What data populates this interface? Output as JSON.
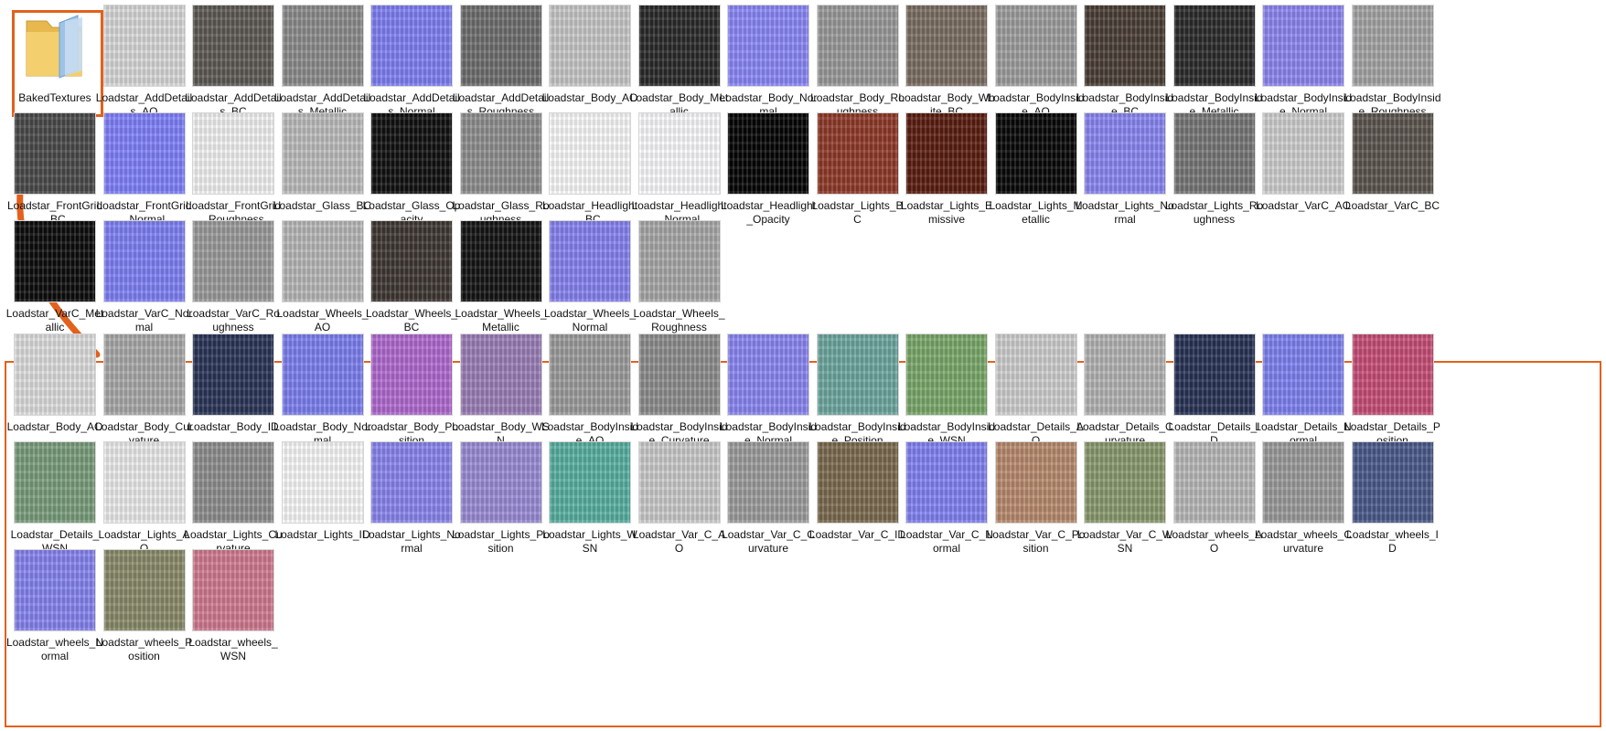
{
  "folder": {
    "name": "BakedTextures",
    "icon": "folder-icon"
  },
  "accent_color": "#e2611c",
  "textures": [
    {
      "label": "Loadstar_AddDetails_AO",
      "color": "#d9d9d9"
    },
    {
      "label": "Loadstar_AddDetails_BC",
      "color": "#5e5a55"
    },
    {
      "label": "Loadstar_AddDetails_Metallic",
      "color": "#8c8c8c"
    },
    {
      "label": "Loadstar_AddDetails_Normal",
      "color": "#7f7ff3"
    },
    {
      "label": "Loadstar_AddDetails_Roughness",
      "color": "#6e6e6e"
    },
    {
      "label": "Loadstar_Body_AO",
      "color": "#c8c8c8"
    },
    {
      "label": "Loadstar_Body_Metallic",
      "color": "#2a2a2a"
    },
    {
      "label": "Loadstar_Body_Normal",
      "color": "#8a88f7"
    },
    {
      "label": "Loadstar_Body_Roughness",
      "color": "#9a9a9a"
    },
    {
      "label": "Loadstar_Body_White_BC",
      "color": "#7a6e62"
    },
    {
      "label": "Loadstar_BodyInside_AO",
      "color": "#9e9e9e"
    },
    {
      "label": "Loadstar_BodyInside_BC",
      "color": "#4a3f36"
    },
    {
      "label": "Loadstar_BodyInside_Metallic",
      "color": "#2b2b2b"
    },
    {
      "label": "Loadstar_BodyInside_Normal",
      "color": "#8d86f0"
    },
    {
      "label": "Loadstar_BodyInside_Roughness",
      "color": "#a5a5a5"
    },
    {
      "label": "Loadstar_FrontGrid_BC",
      "color": "#4a4a4a"
    },
    {
      "label": "Loadstar_FrontGrid_Normal",
      "color": "#8080fb"
    },
    {
      "label": "Loadstar_FrontGrid_Roughness",
      "color": "#f3f3f3"
    },
    {
      "label": "Loadstar_Glass_BC",
      "color": "#bdbdbd"
    },
    {
      "label": "Loadstar_Glass_Opacity",
      "color": "#111111"
    },
    {
      "label": "Loadstar_Glass_Roughness",
      "color": "#8e8e8e"
    },
    {
      "label": "Loadstar_Headlight_BC",
      "color": "#fbfbfb"
    },
    {
      "label": "Loadstar_Headlight_Normal",
      "color": "#fcfcff"
    },
    {
      "label": "Loadstar_Headlight_Opacity",
      "color": "#050505"
    },
    {
      "label": "Loadstar_Lights_BC",
      "color": "#8e3a28"
    },
    {
      "label": "Loadstar_Lights_Emissive",
      "color": "#5a1d10"
    },
    {
      "label": "Loadstar_Lights_Metallic",
      "color": "#080808"
    },
    {
      "label": "Loadstar_Lights_Normal",
      "color": "#8a86f2"
    },
    {
      "label": "Loadstar_Lights_Roughness",
      "color": "#777777"
    },
    {
      "label": "Loadstar_VarC_AO",
      "color": "#cfcfcf"
    },
    {
      "label": "Loadstar_VarC_BC",
      "color": "#5c554f"
    },
    {
      "label": "Loadstar_VarC_Metallic",
      "color": "#0d0d0d"
    },
    {
      "label": "Loadstar_VarC_Normal",
      "color": "#7f80f4"
    },
    {
      "label": "Loadstar_VarC_Roughness",
      "color": "#9b9b9b"
    },
    {
      "label": "Loadstar_Wheels_AO",
      "color": "#b8b8b8"
    },
    {
      "label": "Loadstar_Wheels_BC",
      "color": "#3f3734"
    },
    {
      "label": "Loadstar_Wheels_Metallic",
      "color": "#141414"
    },
    {
      "label": "Loadstar_Wheels_Normal",
      "color": "#8782ef"
    },
    {
      "label": "Loadstar_Wheels_Roughness",
      "color": "#a8a8a8"
    }
  ],
  "baked": [
    {
      "label": "Loadstar_Body_AO",
      "color": "#dedede"
    },
    {
      "label": "Loadstar_Body_Curvature",
      "color": "#a9a9a9"
    },
    {
      "label": "Loadstar_Body_ID",
      "color": "#2a3557"
    },
    {
      "label": "Loadstar_Body_Normal",
      "color": "#7d7ff0"
    },
    {
      "label": "Loadstar_Body_Position",
      "color": "#b06ad0"
    },
    {
      "label": "Loadstar_Body_WSN",
      "color": "#9a7fb8"
    },
    {
      "label": "Loadstar_BodyInside_AO",
      "color": "#9c9c9c"
    },
    {
      "label": "Loadstar_BodyInside_Curvature",
      "color": "#8d8d8d"
    },
    {
      "label": "Loadstar_BodyInside_Normal",
      "color": "#8a86f2"
    },
    {
      "label": "Loadstar_BodyInside_Position",
      "color": "#6fa7a0"
    },
    {
      "label": "Loadstar_BodyInside_WSN",
      "color": "#7aa86a"
    },
    {
      "label": "Loadstar_Details_AO",
      "color": "#cfcfcf"
    },
    {
      "label": "Loadstar_Details_Curvature",
      "color": "#b4b4b4"
    },
    {
      "label": "Loadstar_Details_ID",
      "color": "#283456"
    },
    {
      "label": "Loadstar_Details_Normal",
      "color": "#7f82f1"
    },
    {
      "label": "Loadstar_Details_Position",
      "color": "#c74e78"
    },
    {
      "label": "Loadstar_Details_WSN",
      "color": "#7a9d7c"
    },
    {
      "label": "Loadstar_Lights_AO",
      "color": "#ececec"
    },
    {
      "label": "Loadstar_Lights_Curvature",
      "color": "#8e8e8e"
    },
    {
      "label": "Loadstar_Lights_ID",
      "color": "#fafafa"
    },
    {
      "label": "Loadstar_Lights_Normal",
      "color": "#8a85ee"
    },
    {
      "label": "Loadstar_Lights_Position",
      "color": "#9a8cd6"
    },
    {
      "label": "Loadstar_Lights_WSN",
      "color": "#58b0a0"
    },
    {
      "label": "Loadstar_Var_C_AO",
      "color": "#cbcbcb"
    },
    {
      "label": "Loadstar_Var_C_Curvature",
      "color": "#9d9d9d"
    },
    {
      "label": "Loadstar_Var_C_ID",
      "color": "#7b6a4f"
    },
    {
      "label": "Loadstar_Var_C_Normal",
      "color": "#8282f2"
    },
    {
      "label": "Loadstar_Var_C_Position",
      "color": "#b98a6e"
    },
    {
      "label": "Loadstar_Var_C_WSN",
      "color": "#8a9a6e"
    },
    {
      "label": "Loadstar_wheels_AO",
      "color": "#b9b9b9"
    },
    {
      "label": "Loadstar_wheels_Curvature",
      "color": "#9b9b9b"
    },
    {
      "label": "Loadstar_wheels_ID",
      "color": "#4a5a8a"
    },
    {
      "label": "Loadstar_wheels_Normal",
      "color": "#8684ef"
    },
    {
      "label": "Loadstar_wheels_Position",
      "color": "#8a8a6a"
    },
    {
      "label": "Loadstar_wheels_WSN",
      "color": "#d07a90"
    }
  ]
}
